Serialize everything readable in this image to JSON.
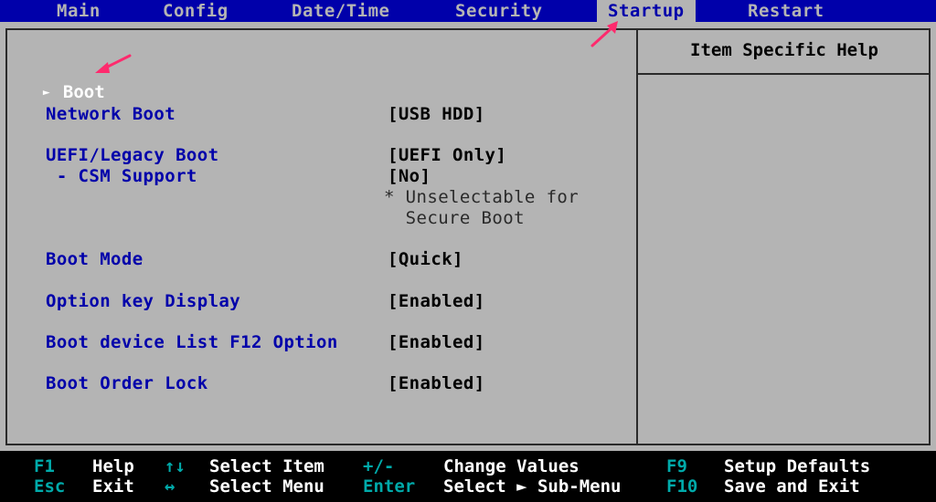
{
  "menubar": {
    "tabs": [
      {
        "label": "Main"
      },
      {
        "label": "Config"
      },
      {
        "label": "Date/Time"
      },
      {
        "label": "Security"
      },
      {
        "label": "Startup"
      },
      {
        "label": "Restart"
      }
    ],
    "active_tab": "Startup"
  },
  "settings": {
    "boot": {
      "label": "Boot"
    },
    "network_boot": {
      "label": "Network Boot",
      "value": "[USB HDD]"
    },
    "uefi_legacy_boot": {
      "label": "UEFI/Legacy Boot",
      "value": "[UEFI Only]"
    },
    "csm_support": {
      "label": " - CSM Support",
      "value": "[No]",
      "note_line1": "* Unselectable for",
      "note_line2": "  Secure Boot"
    },
    "boot_mode": {
      "label": "Boot Mode",
      "value": "[Quick]"
    },
    "option_key_display": {
      "label": "Option key Display",
      "value": "[Enabled]"
    },
    "boot_device_list": {
      "label": "Boot device List F12 Option",
      "value": "[Enabled]"
    },
    "boot_order_lock": {
      "label": "Boot Order Lock",
      "value": "[Enabled]"
    }
  },
  "help_panel": {
    "title": "Item Specific Help"
  },
  "footer": {
    "row1": [
      {
        "key": "F1",
        "desc": "Help"
      },
      {
        "key": "↑↓",
        "desc": "Select Item"
      },
      {
        "key": "+/-",
        "desc": "Change Values"
      },
      {
        "key": "F9",
        "desc": "Setup Defaults"
      }
    ],
    "row2": [
      {
        "key": "Esc",
        "desc": "Exit"
      },
      {
        "key": "↔",
        "desc": "Select Menu"
      },
      {
        "key": "Enter",
        "desc": "Select ► Sub-Menu"
      },
      {
        "key": "F10",
        "desc": "Save and Exit"
      }
    ]
  },
  "colors": {
    "menubar_bg": "#0000aa",
    "panel_bg": "#b4b4b4",
    "label": "#0000aa",
    "annotation": "#ff2a6d"
  }
}
